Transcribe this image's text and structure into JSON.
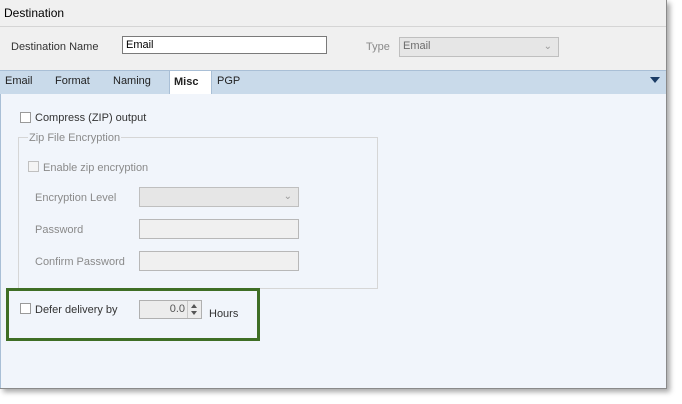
{
  "dialog": {
    "title": "Destination",
    "destination_name_label": "Destination Name",
    "destination_name_value": "Email",
    "type_label": "Type",
    "type_value": "Email"
  },
  "tabs": [
    {
      "label": "Email",
      "active": false
    },
    {
      "label": "Format",
      "active": false
    },
    {
      "label": "Naming",
      "active": false
    },
    {
      "label": "Misc",
      "active": true
    },
    {
      "label": "PGP",
      "active": false
    }
  ],
  "misc": {
    "compress_label": "Compress (ZIP) output",
    "compress_checked": false,
    "zip_group_title": "Zip File Encryption",
    "enable_zip_label": "Enable zip encryption",
    "encryption_level_label": "Encryption Level",
    "encryption_level_value": "",
    "password_label": "Password",
    "password_value": "",
    "confirm_password_label": "Confirm Password",
    "confirm_password_value": "",
    "defer_label": "Defer delivery by",
    "defer_checked": false,
    "defer_value": "0.0",
    "hours_label": "Hours"
  },
  "colors": {
    "tab_bar": "#c9daea",
    "panel_bg": "#f1f5fb",
    "highlight_border": "#3f6e25"
  }
}
